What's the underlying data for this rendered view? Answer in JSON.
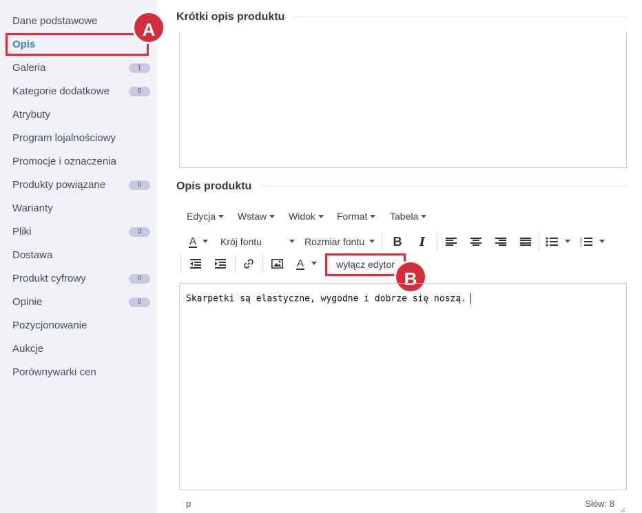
{
  "sidebar": {
    "items": [
      {
        "label": "Dane podstawowe",
        "badge": null,
        "active": false
      },
      {
        "label": "Opis",
        "badge": null,
        "active": true
      },
      {
        "label": "Galeria",
        "badge": "1",
        "active": false
      },
      {
        "label": "Kategorie dodatkowe",
        "badge": "0",
        "active": false
      },
      {
        "label": "Atrybuty",
        "badge": null,
        "active": false
      },
      {
        "label": "Program lojalnościowy",
        "badge": null,
        "active": false
      },
      {
        "label": "Promocje i oznaczenia",
        "badge": null,
        "active": false
      },
      {
        "label": "Produkty powiązane",
        "badge": "0",
        "active": false
      },
      {
        "label": "Warianty",
        "badge": null,
        "active": false
      },
      {
        "label": "Pliki",
        "badge": "0",
        "active": false
      },
      {
        "label": "Dostawa",
        "badge": null,
        "active": false
      },
      {
        "label": "Produkt cyfrowy",
        "badge": "0",
        "active": false
      },
      {
        "label": "Opinie",
        "badge": "0",
        "active": false
      },
      {
        "label": "Pozycjonowanie",
        "badge": null,
        "active": false
      },
      {
        "label": "Aukcje",
        "badge": null,
        "active": false
      },
      {
        "label": "Porównywarki cen",
        "badge": null,
        "active": false
      }
    ]
  },
  "markers": {
    "a": "A",
    "b": "B"
  },
  "short_description": {
    "title": "Krótki opis produktu"
  },
  "description": {
    "title": "Opis produktu",
    "menu": [
      "Edycja",
      "Wstaw",
      "Widok",
      "Format",
      "Tabela"
    ],
    "font_family_label": "Krój fontu",
    "font_size_label": "Rozmiar fontu",
    "bold_label": "B",
    "italic_label": "I",
    "text_color_label": "A",
    "bg_color_label": "A",
    "disable_editor_label": "wyłącz edytor",
    "content": "Skarpetki są elastyczne, wygodne i dobrze się noszą.",
    "status_path": "p",
    "word_count": "Słów: 8"
  },
  "colors": {
    "accent": "#3b7ddd",
    "highlight": "#d9303f",
    "sidebar_bg": "#f1f2f7"
  }
}
